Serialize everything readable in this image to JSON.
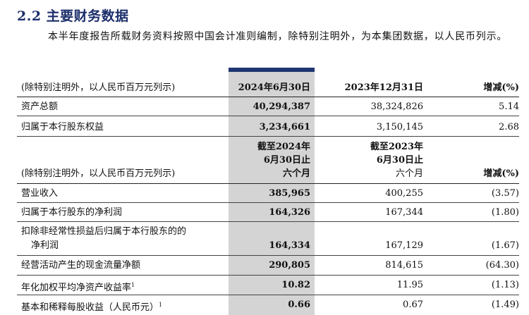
{
  "section": {
    "heading": "2.2 主要财务数据",
    "intro": "本半年度报告所载财务资料按照中国会计准则编制，除特别注明外，为本集团数据，以人民币列示。"
  },
  "table1": {
    "unit_label": "(除特别注明外，以人民币百万元列示)",
    "col1": "2024年6月30日",
    "col2": "2023年12月31日",
    "col3": "增减(%)",
    "rows": [
      {
        "label": "资产总额",
        "v1": "40,294,387",
        "v2": "38,324,826",
        "v3": "5.14"
      },
      {
        "label": "归属于本行股东权益",
        "v1": "3,234,661",
        "v2": "3,150,145",
        "v3": "2.68"
      }
    ]
  },
  "table2": {
    "unit_label": "(除特别注明外，以人民币百万元列示)",
    "col1_line1": "截至2024年",
    "col1_line2": "6月30日止",
    "col1_line3": "六个月",
    "col2_line1": "截至2023年",
    "col2_line2": "6月30日止",
    "col2_line3": "六个月",
    "col3": "增减(%)",
    "rows": [
      {
        "label": "营业收入",
        "v1": "385,965",
        "v2": "400,255",
        "v3": "(3.57)"
      },
      {
        "label": "归属于本行股东的净利润",
        "v1": "164,326",
        "v2": "167,344",
        "v3": "(1.80)"
      },
      {
        "label": "扣除非经常性损益后归属于本行股东的的",
        "label2": "净利润",
        "v1": "164,334",
        "v2": "167,129",
        "v3": "(1.67)"
      },
      {
        "label": "经营活动产生的现金流量净额",
        "v1": "290,805",
        "v2": "814,615",
        "v3": "(64.30)"
      },
      {
        "label": "年化加权平均净资产收益率",
        "note": "1",
        "v1": "10.82",
        "v2": "11.95",
        "v3": "(1.13)"
      },
      {
        "label": "基本和稀释每股收益（人民币元）",
        "note": "1",
        "v1": "0.66",
        "v2": "0.67",
        "v3": "(1.49)"
      }
    ]
  }
}
